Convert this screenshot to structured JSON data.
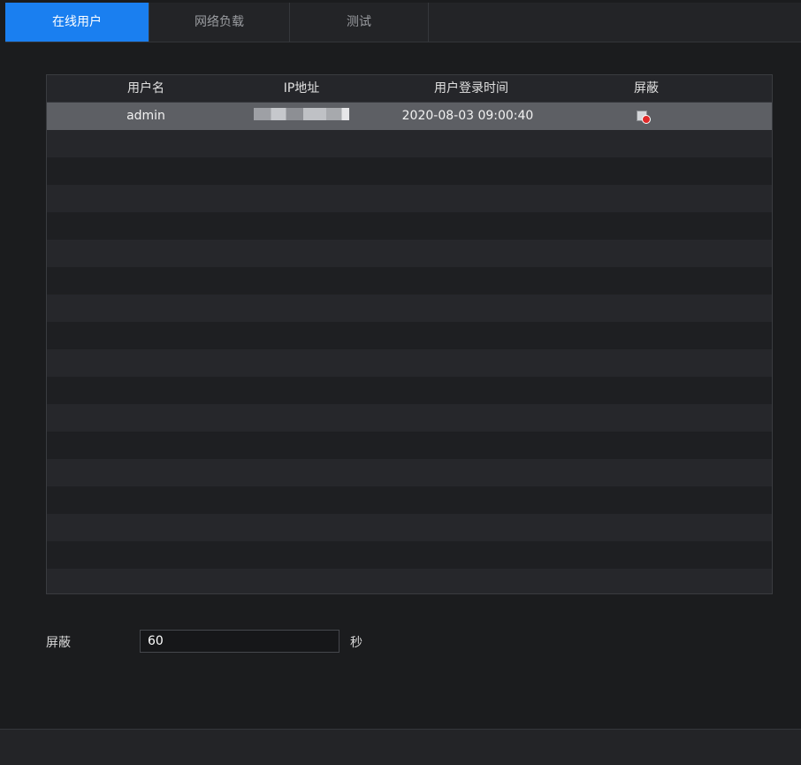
{
  "tabs": [
    {
      "label": "在线用户",
      "active": true
    },
    {
      "label": "网络负载",
      "active": false
    },
    {
      "label": "测试",
      "active": false
    }
  ],
  "table": {
    "headers": {
      "username": "用户名",
      "ip": "IP地址",
      "login_time": "用户登录时间",
      "block": "屏蔽"
    },
    "rows": [
      {
        "username": "admin",
        "ip": "",
        "login_time": "2020-08-03 09:00:40",
        "block_icon": "block-user-icon"
      }
    ]
  },
  "block_setting": {
    "label": "屏蔽",
    "value": "60",
    "unit": "秒"
  },
  "colors": {
    "accent": "#1a7ff0",
    "selected_row": "#5d5f64",
    "block_dot": "#e02a2a"
  }
}
